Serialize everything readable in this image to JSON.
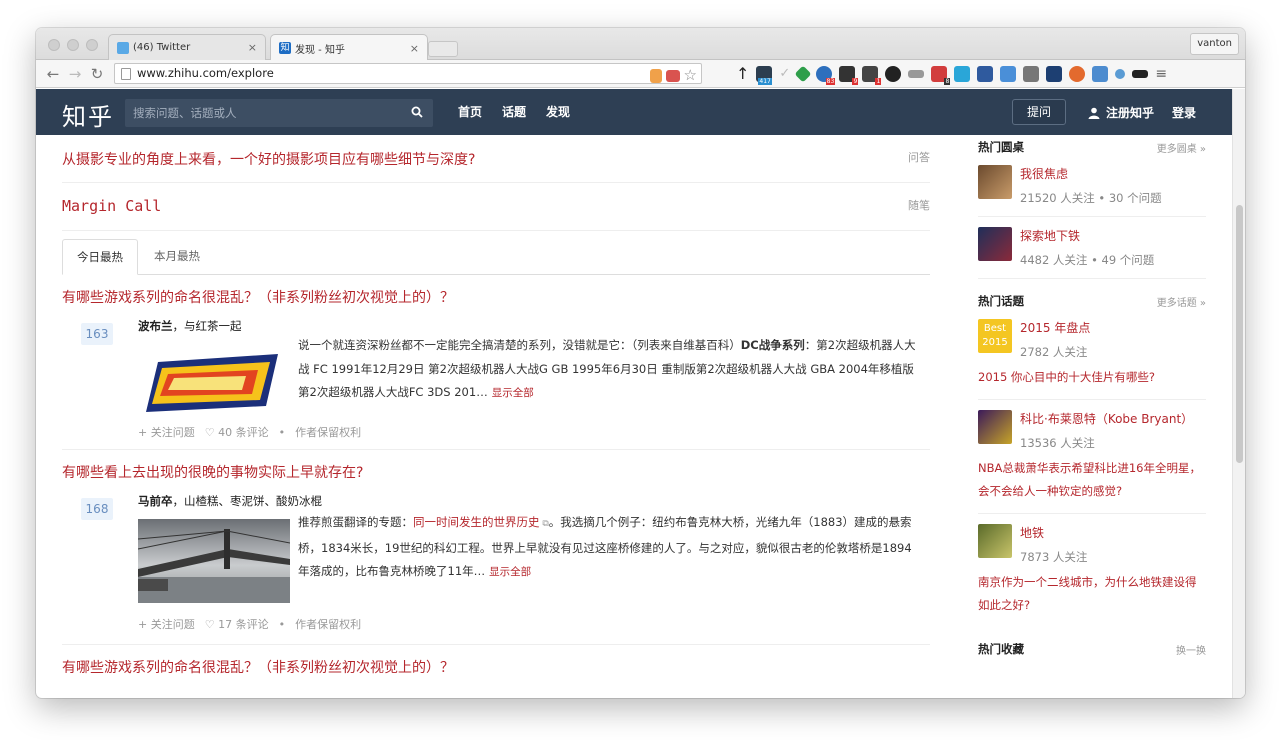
{
  "browser": {
    "tabs": [
      {
        "title": "(46) Twitter",
        "icon": "twitter-icon",
        "close": "×"
      },
      {
        "title": "发现 - 知乎",
        "icon": "zhihu-icon",
        "close": "×"
      }
    ],
    "user": "vanton",
    "url": "www.zhihu.com/explore",
    "extension_badges": [
      "417",
      "83",
      "9",
      "8",
      "1"
    ]
  },
  "header": {
    "logo": "知乎",
    "search_placeholder": "搜索问题、话题或人",
    "nav": [
      "首页",
      "话题",
      "发现"
    ],
    "ask": "提问",
    "register": "注册知乎",
    "login": "登录"
  },
  "highlights": [
    {
      "title": "从摄影专业的角度上来看，一个好的摄影项目应有哪些细节与深度?",
      "tag": "问答"
    },
    {
      "title": "Margin Call",
      "tag": "随笔"
    }
  ],
  "feed_tabs": [
    "今日最热",
    "本月最热"
  ],
  "feed": [
    {
      "question": "有哪些游戏系列的命名很混乱？（非系列粉丝初次视觉上的）？",
      "votes": "163",
      "author": "波布兰",
      "author_bio": "，与红茶一起",
      "excerpt_a": "说一个就连资深粉丝都不一定能完全搞清楚的系列，没错就是它：（列表来自维基百科）",
      "excerpt_b": "DC战争系列",
      "excerpt_c": "：第2次超级机器人大战 FC 1991年12月29日 第2次超级机器人大战G GB 1995年6月30日 重制版第2次超级机器人大战 GBA 2004年移植版第2次超级机器人大战FC 3DS 201…",
      "show_all": "显示全部",
      "follow": "+ 关注问题",
      "comments": "40 条评论",
      "rights": "作者保留权利"
    },
    {
      "question": "有哪些看上去出现的很晚的事物实际上早就存在?",
      "votes": "168",
      "author": "马前卒",
      "author_bio": "，山楂糕、枣泥饼、酸奶冰棍",
      "excerpt_a": "推荐煎蛋翻译的专题：",
      "excerpt_link": "同一时间发生的世界历史",
      "excerpt_c": "。我选摘几个例子：纽约布鲁克林大桥，光绪九年（1883）建成的悬索桥，1834米长，19世纪的科幻工程。世界上早就没有见过这座桥修建的人了。与之对应，貌似很古老的伦敦塔桥是1894年落成的，比布鲁克林桥晚了11年…",
      "show_all": "显示全部",
      "follow": "+ 关注问题",
      "comments": "17 条评论",
      "rights": "作者保留权利"
    },
    {
      "question": "有哪些游戏系列的命名很混乱？（非系列粉丝初次视觉上的）？"
    }
  ],
  "sidebar": {
    "roundtable": {
      "title": "热门圆桌",
      "more": "更多圆桌 »",
      "items": [
        {
          "name": "我很焦虑",
          "meta": "21520 人关注 • 30 个问题"
        },
        {
          "name": "探索地下铁",
          "meta": "4482 人关注 • 49 个问题"
        }
      ]
    },
    "topics": {
      "title": "热门话题",
      "more": "更多话题 »",
      "items": [
        {
          "name": "2015 年盘点",
          "meta": "2782 人关注",
          "question": "2015 你心目中的十大佳片有哪些?"
        },
        {
          "name": "科比·布莱恩特（Kobe Bryant）",
          "meta": "13536 人关注",
          "question": "NBA总裁萧华表示希望科比进16年全明星，会不会给人一种钦定的感觉?"
        },
        {
          "name": "地铁",
          "meta": "7873 人关注",
          "question": "南京作为一个二线城市，为什么地铁建设得如此之好?"
        }
      ]
    },
    "collections": {
      "title": "热门收藏",
      "more": "换一换"
    }
  }
}
